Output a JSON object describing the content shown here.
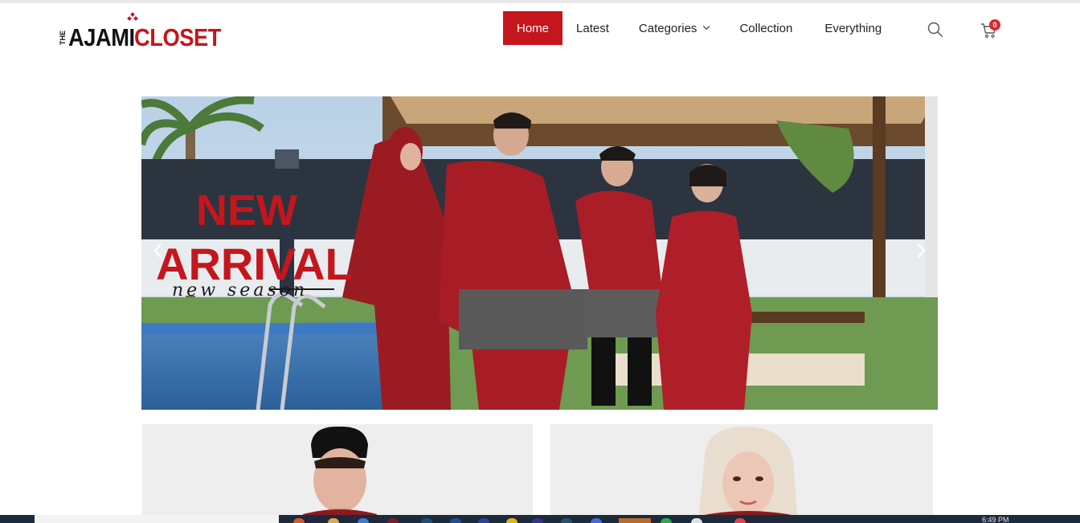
{
  "header": {
    "logo": {
      "the": "THE",
      "ajami": "AJAMI",
      "closet": "CLOSET"
    },
    "nav": [
      {
        "label": "Home",
        "active": true
      },
      {
        "label": "Latest",
        "active": false
      },
      {
        "label": "Categories",
        "active": false,
        "has_dropdown": true
      },
      {
        "label": "Collection",
        "active": false
      },
      {
        "label": "Everything",
        "active": false
      }
    ],
    "cart_count": "0",
    "icons": [
      "search-icon",
      "cart-icon"
    ]
  },
  "hero": {
    "headline_1": "NEW",
    "headline_2": "ARRIVAL",
    "tagline": "new season"
  },
  "taskbar": {
    "time": "6:49 PM"
  },
  "colors": {
    "brand_red": "#c4161c",
    "badge_red": "#e0262c",
    "card_bg": "#eeeeee",
    "taskbar": "#1c2a3b"
  }
}
